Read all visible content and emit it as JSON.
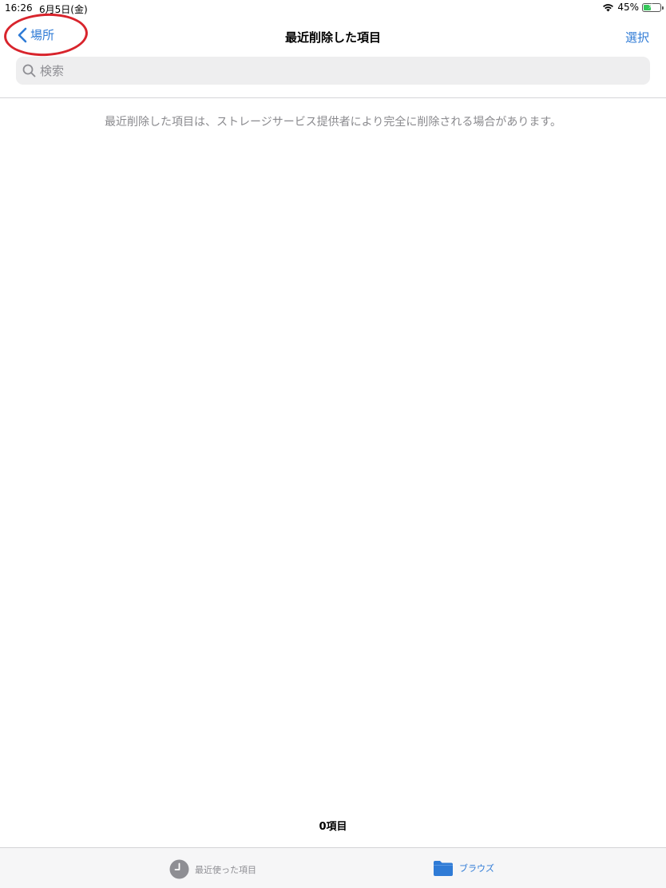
{
  "status_bar": {
    "time": "16:26",
    "date": "6月5日(金)",
    "battery": "45%",
    "battery_level": 0.45
  },
  "nav": {
    "back_label": "場所",
    "title": "最近削除した項目",
    "select_label": "選択"
  },
  "search": {
    "placeholder": "検索"
  },
  "content": {
    "message": "最近削除した項目は、ストレージサービス提供者により完全に削除される場合があります。",
    "item_count": "0項目"
  },
  "tab_bar": {
    "recents_label": "最近使った項目",
    "browse_label": "ブラウズ"
  },
  "colors": {
    "accent": "#2f7bd6",
    "annotation": "#d8242c",
    "battery_fill": "#34c759"
  }
}
